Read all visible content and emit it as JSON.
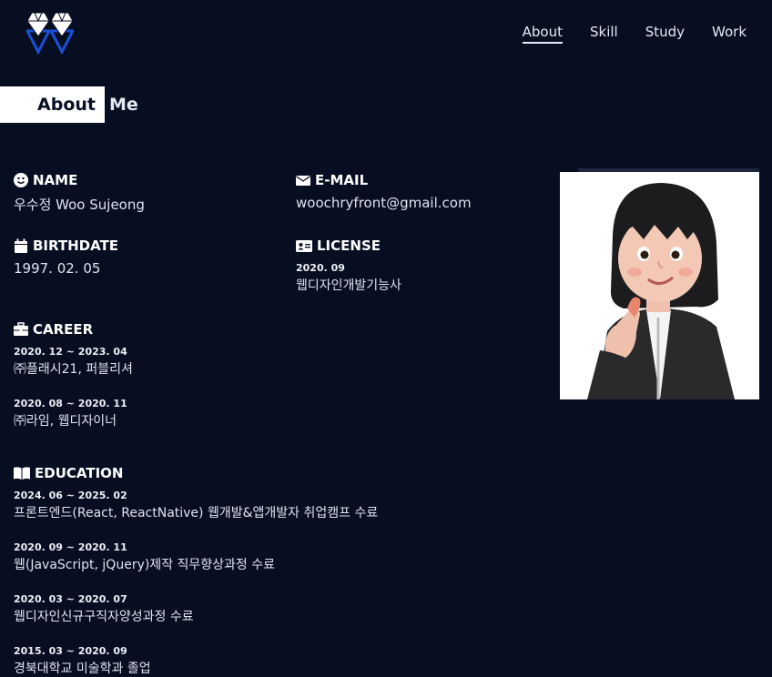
{
  "header": {
    "logo": "diamond-w-logo",
    "nav": [
      {
        "label": "About",
        "active": true
      },
      {
        "label": "Skill",
        "active": false
      },
      {
        "label": "Study",
        "active": false
      },
      {
        "label": "Work",
        "active": false
      }
    ]
  },
  "section": {
    "title_box": "About",
    "title_rest": "Me"
  },
  "name": {
    "label": "NAME",
    "value": "우수정 Woo Sujeong"
  },
  "email": {
    "label": "E-MAIL",
    "value": "woochryfront@gmail.com"
  },
  "birthdate": {
    "label": "BIRTHDATE",
    "value": "1997. 02. 05"
  },
  "license": {
    "label": "LICENSE",
    "date": "2020. 09",
    "value": "웹디자인개발기능사"
  },
  "career": {
    "label": "CAREER",
    "items": [
      {
        "date": "2020. 12 ~ 2023. 04",
        "desc": "㈜플래시21, 퍼블리셔"
      },
      {
        "date": "2020. 08 ~ 2020. 11",
        "desc": "㈜라임, 웹디자이너"
      }
    ]
  },
  "education": {
    "label": "EDUCATION",
    "items": [
      {
        "date": "2024. 06 ~ 2025. 02",
        "desc": "프론트엔드(React, ReactNative) 웹개발&앱개발자 취업캠프 수료"
      },
      {
        "date": "2020. 09 ~ 2020. 11",
        "desc": "웹(JavaScript, jQuery)제작 직무향상과정 수료"
      },
      {
        "date": "2020. 03 ~ 2020. 07",
        "desc": "웹디자인신규구직자양성과정 수료"
      },
      {
        "date": "2015. 03 ~ 2020. 09",
        "desc": "경북대학교 미술학과 졸업"
      }
    ]
  },
  "colors": {
    "background": "#080e22",
    "accent_logo": "#1a4fd6",
    "text": "#dfe3ee"
  }
}
